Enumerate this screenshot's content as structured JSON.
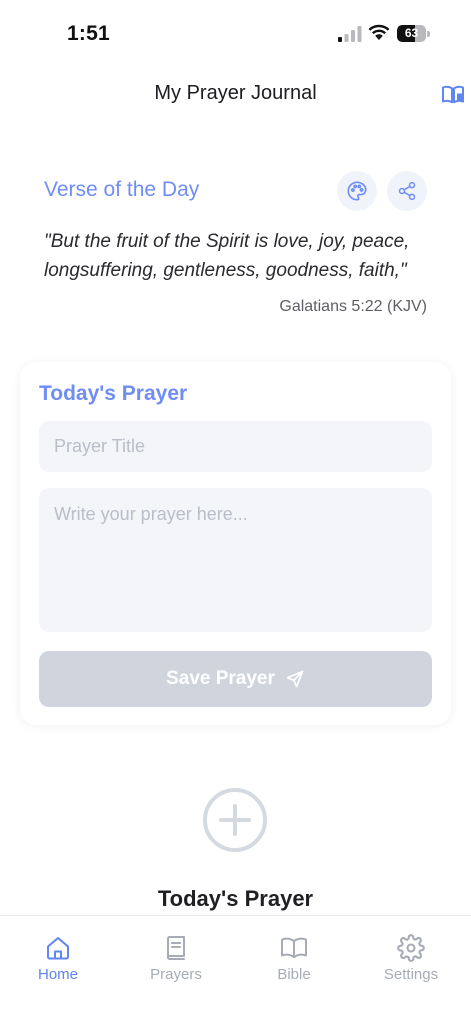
{
  "status_bar": {
    "time": "1:51",
    "battery_level": "63"
  },
  "header": {
    "title": "My Prayer Journal",
    "icon": "book-open-icon"
  },
  "verse": {
    "heading": "Verse of the Day",
    "text": "\"But the fruit of the Spirit is love, joy, peace, longsuffering, gentleness, goodness, faith,\"",
    "reference": "Galatians 5:22 (KJV)",
    "actions": [
      "palette-icon",
      "share-icon"
    ]
  },
  "prayer_form": {
    "heading": "Today's Prayer",
    "title_placeholder": "Prayer Title",
    "body_placeholder": "Write your prayer here...",
    "save_label": "Save Prayer",
    "save_icon": "send-icon"
  },
  "empty_state": {
    "icon": "plus-circle-icon",
    "title": "Today's Prayer"
  },
  "tabs": [
    {
      "label": "Home",
      "icon": "home-icon",
      "active": true
    },
    {
      "label": "Prayers",
      "icon": "book-icon",
      "active": false
    },
    {
      "label": "Bible",
      "icon": "book-open-icon",
      "active": false
    },
    {
      "label": "Settings",
      "icon": "gear-icon",
      "active": false
    }
  ],
  "colors": {
    "accent": "#6f8ef5",
    "tab_active": "#5f86f1",
    "tab_inactive": "#a6abb5",
    "input_bg": "#f3f5f8",
    "button_disabled": "#d0d5dd"
  }
}
